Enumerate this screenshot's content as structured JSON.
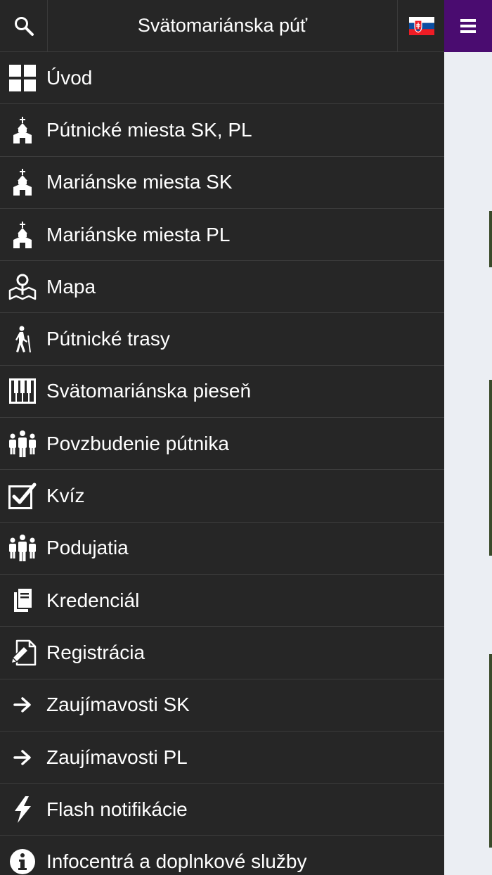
{
  "header": {
    "title": "Svätomariánska púť",
    "search_icon": "search-icon",
    "flag_icon": "slovak-flag-icon",
    "menu_icon": "hamburger-menu-icon",
    "menu_color": "#4a0c70"
  },
  "menu": {
    "items": [
      {
        "label": "Úvod",
        "icon": "grid-icon"
      },
      {
        "label": "Pútnické miesta SK, PL",
        "icon": "church-icon"
      },
      {
        "label": "Mariánske miesta SK",
        "icon": "church-icon"
      },
      {
        "label": "Mariánske miesta PL",
        "icon": "church-icon"
      },
      {
        "label": "Mapa",
        "icon": "map-pin-icon"
      },
      {
        "label": "Pútnické trasy",
        "icon": "hiker-icon"
      },
      {
        "label": "Svätomariánska pieseň",
        "icon": "piano-icon"
      },
      {
        "label": "Povzbudenie pútnika",
        "icon": "people-group-icon"
      },
      {
        "label": "Kvíz",
        "icon": "checkbox-icon"
      },
      {
        "label": "Podujatia",
        "icon": "people-group-icon"
      },
      {
        "label": "Kredenciál",
        "icon": "document-icon"
      },
      {
        "label": "Registrácia",
        "icon": "edit-icon"
      },
      {
        "label": "Zaujímavosti SK",
        "icon": "arrow-right-icon"
      },
      {
        "label": "Zaujímavosti PL",
        "icon": "arrow-right-icon"
      },
      {
        "label": "Flash notifikácie",
        "icon": "lightning-icon"
      },
      {
        "label": "Infocentrá a doplnkové služby",
        "icon": "info-icon"
      }
    ]
  },
  "colors": {
    "drawer_bg": "#262626",
    "text": "#ffffff",
    "page_bg": "#ebeef3"
  }
}
